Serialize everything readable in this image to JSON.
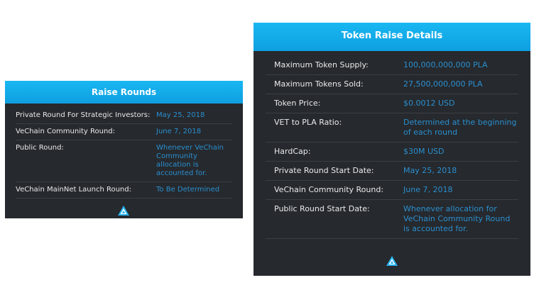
{
  "raise_rounds": {
    "title": "Raise Rounds",
    "rows": [
      {
        "label": "Private Round For Strategic Investors:",
        "value": "May 25, 2018"
      },
      {
        "label": "VeChain Community Round:",
        "value": "June 7, 2018"
      },
      {
        "label": "Public Round:",
        "value": "Whenever VeChain Community allocation is accounted for."
      },
      {
        "label": "VeChain MainNet Launch Round:",
        "value": "To Be Determined"
      }
    ],
    "logo_icon": "triangle-logo-icon"
  },
  "token_raise": {
    "title": "Token Raise Details",
    "rows": [
      {
        "label": "Maximum Token Supply:",
        "value": "100,000,000,000 PLA"
      },
      {
        "label": "Maximum Tokens Sold:",
        "value": "27,500,000,000 PLA"
      },
      {
        "label": "Token Price:",
        "value": "$0.0012 USD"
      },
      {
        "label": "VET to PLA Ratio:",
        "value": "Determined at the beginning of each round"
      },
      {
        "label": "HardCap:",
        "value": "$30M USD"
      },
      {
        "label": "Private Round Start Date:",
        "value": "May 25, 2018"
      },
      {
        "label": "VeChain Community Round:",
        "value": "June 7, 2018"
      },
      {
        "label": "Public Round Start Date:",
        "value": "Whenever allocation for VeChain Community Round is accounted for."
      }
    ],
    "logo_icon": "triangle-logo-icon"
  },
  "colors": {
    "header_blue": "#15adeb",
    "card_bg": "#26292d",
    "label_text": "#e9eaec",
    "value_text": "#2a8fd0"
  }
}
